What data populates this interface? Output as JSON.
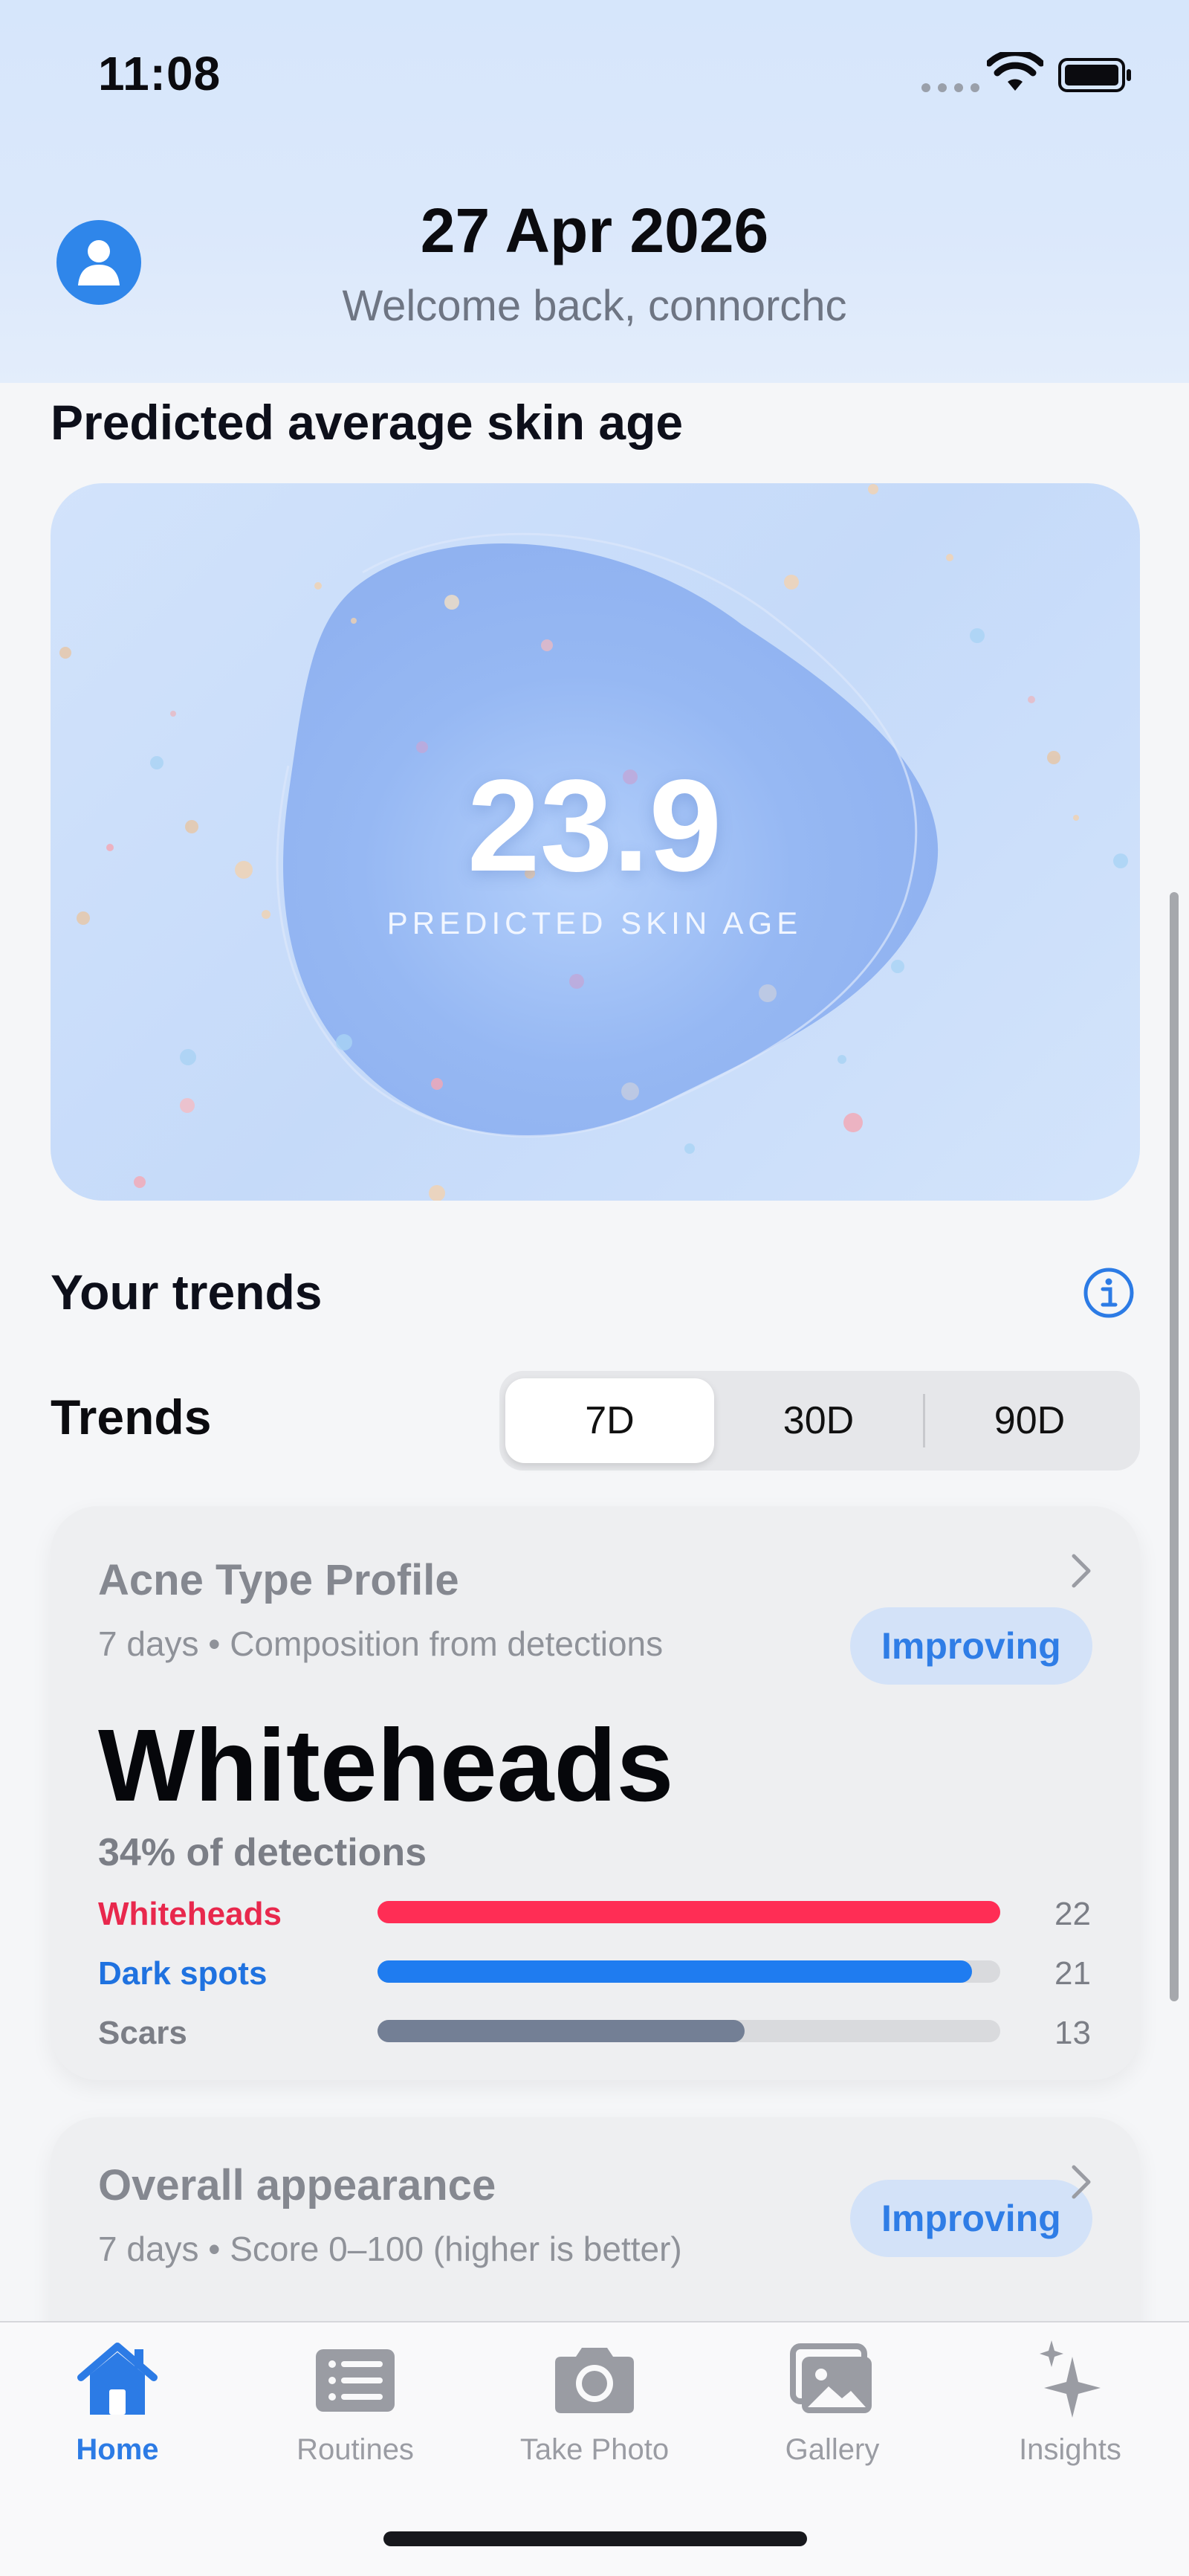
{
  "status_bar": {
    "time": "11:08"
  },
  "header": {
    "date": "27 Apr 2026",
    "welcome": "Welcome back, connorchc"
  },
  "skin_age": {
    "section_title": "Predicted average skin age",
    "value": "23.9",
    "caption": "PREDICTED SKIN AGE"
  },
  "trends": {
    "section_title": "Your trends",
    "label": "Trends",
    "ranges": [
      "7D",
      "30D",
      "90D"
    ],
    "selected_range": "7D"
  },
  "acne_card": {
    "title": "Acne Type Profile",
    "subtitle": "7 days • Composition from detections",
    "status": "Improving",
    "dominant_type": "Whiteheads",
    "dominant_share": "34% of detections",
    "rows": [
      {
        "label": "Whiteheads",
        "count": "22",
        "fill": 1.0,
        "color": "#ff2d55"
      },
      {
        "label": "Dark spots",
        "count": "21",
        "fill": 0.955,
        "color": "#1f7cf0"
      },
      {
        "label": "Scars",
        "count": "13",
        "fill": 0.59,
        "color": "#737f95"
      }
    ]
  },
  "appearance_card": {
    "title": "Overall appearance",
    "subtitle": "7 days • Score 0–100 (higher is better)",
    "status": "Improving"
  },
  "tab_bar": {
    "tabs": [
      {
        "label": "Home",
        "icon": "house-icon"
      },
      {
        "label": "Routines",
        "icon": "list-icon"
      },
      {
        "label": "Take Photo",
        "icon": "camera-icon"
      },
      {
        "label": "Gallery",
        "icon": "photos-icon"
      },
      {
        "label": "Insights",
        "icon": "sparkles-icon"
      }
    ],
    "active": "Home"
  },
  "colors": {
    "accent": "#2c7be5",
    "whiteheads": "#ff2d55",
    "dark_spots": "#1f7cf0",
    "scars": "#737f95"
  }
}
